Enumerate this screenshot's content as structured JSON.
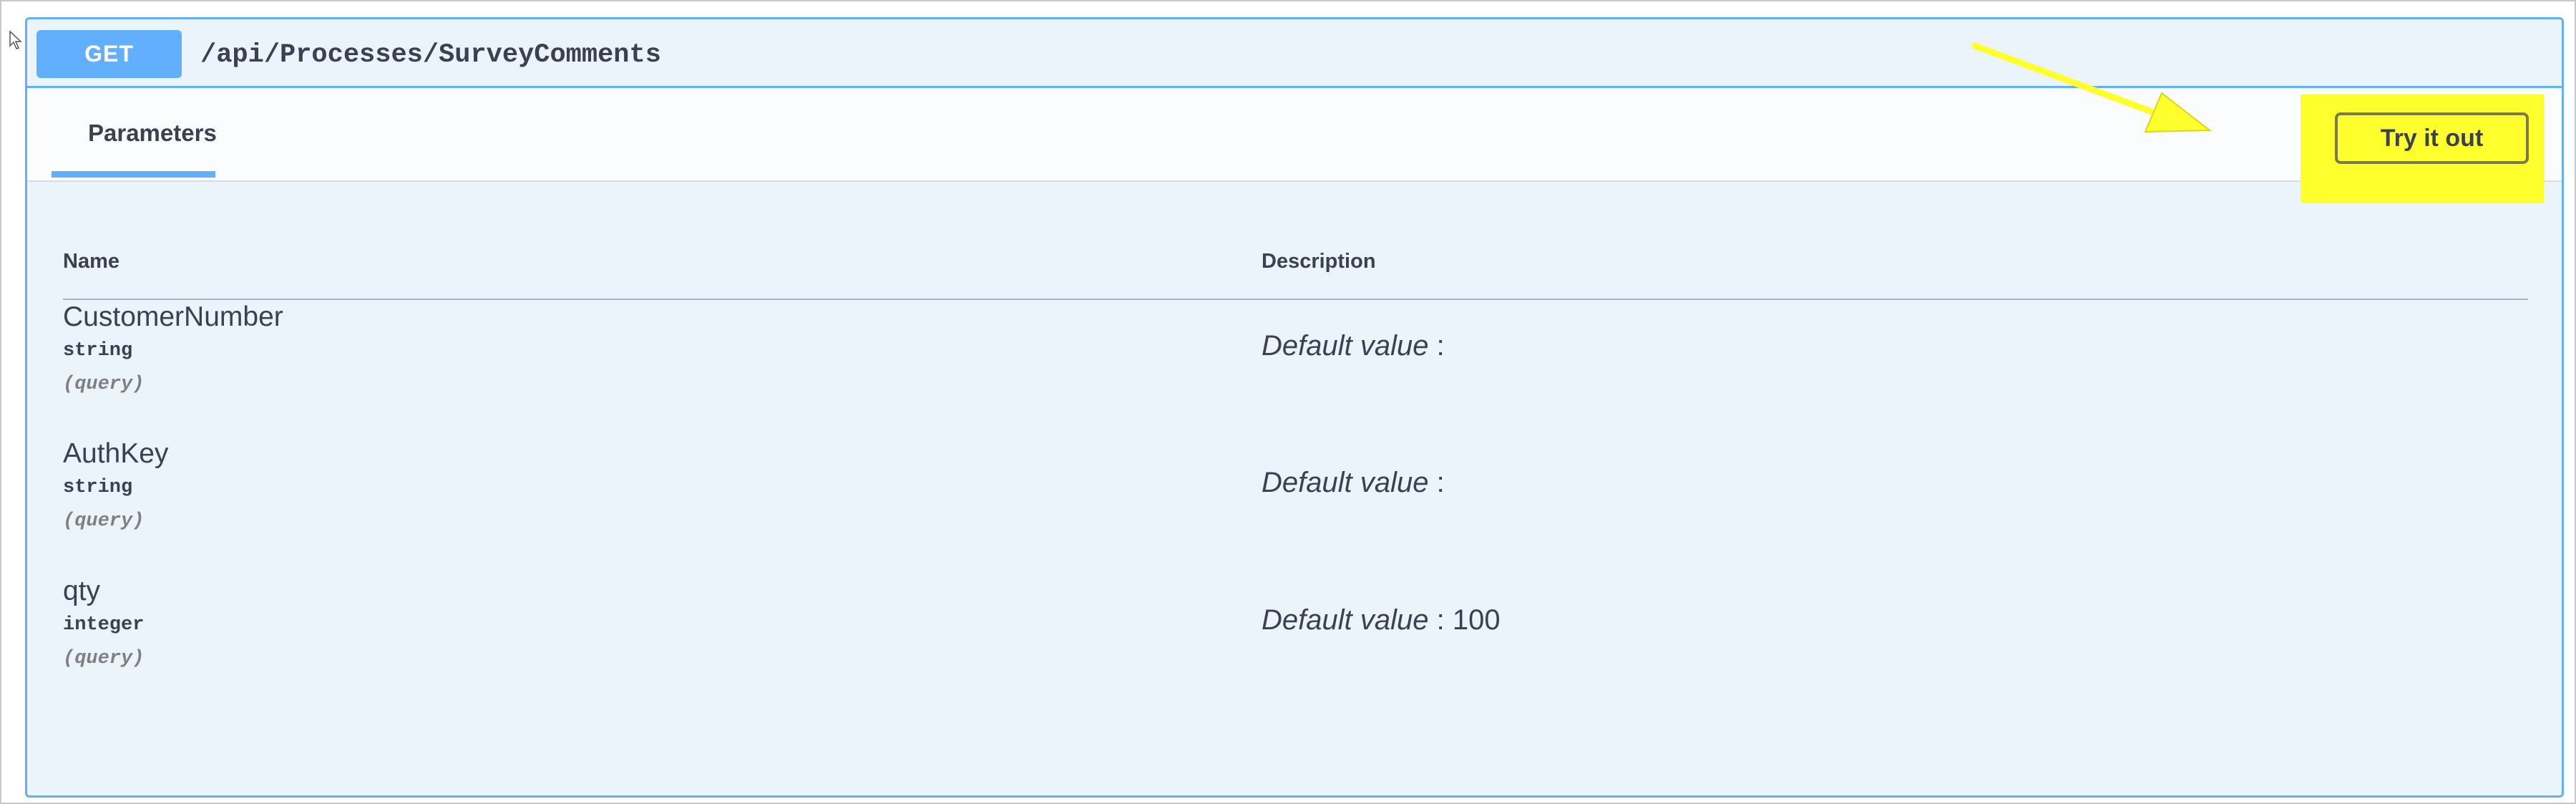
{
  "operation": {
    "method": "GET",
    "path": "/api/Processes/SurveyComments"
  },
  "section": {
    "tab_label": "Parameters",
    "try_button_label": "Try it out"
  },
  "table": {
    "headers": {
      "name": "Name",
      "description": "Description"
    },
    "parameters": [
      {
        "name": "CustomerNumber",
        "type": "string",
        "in": "(query)",
        "default_label": "Default value",
        "separator": " : ",
        "default_value": ""
      },
      {
        "name": "AuthKey",
        "type": "string",
        "in": "(query)",
        "default_label": "Default value",
        "separator": " : ",
        "default_value": ""
      },
      {
        "name": "qty",
        "type": "integer",
        "in": "(query)",
        "default_label": "Default value",
        "separator": " : ",
        "default_value": "100"
      }
    ]
  },
  "annotation": {
    "highlight_color": "#ffff2e",
    "arrow_color": "#ffff2e"
  },
  "colors": {
    "accent": "#61affe",
    "background": "#ebf3fb"
  }
}
